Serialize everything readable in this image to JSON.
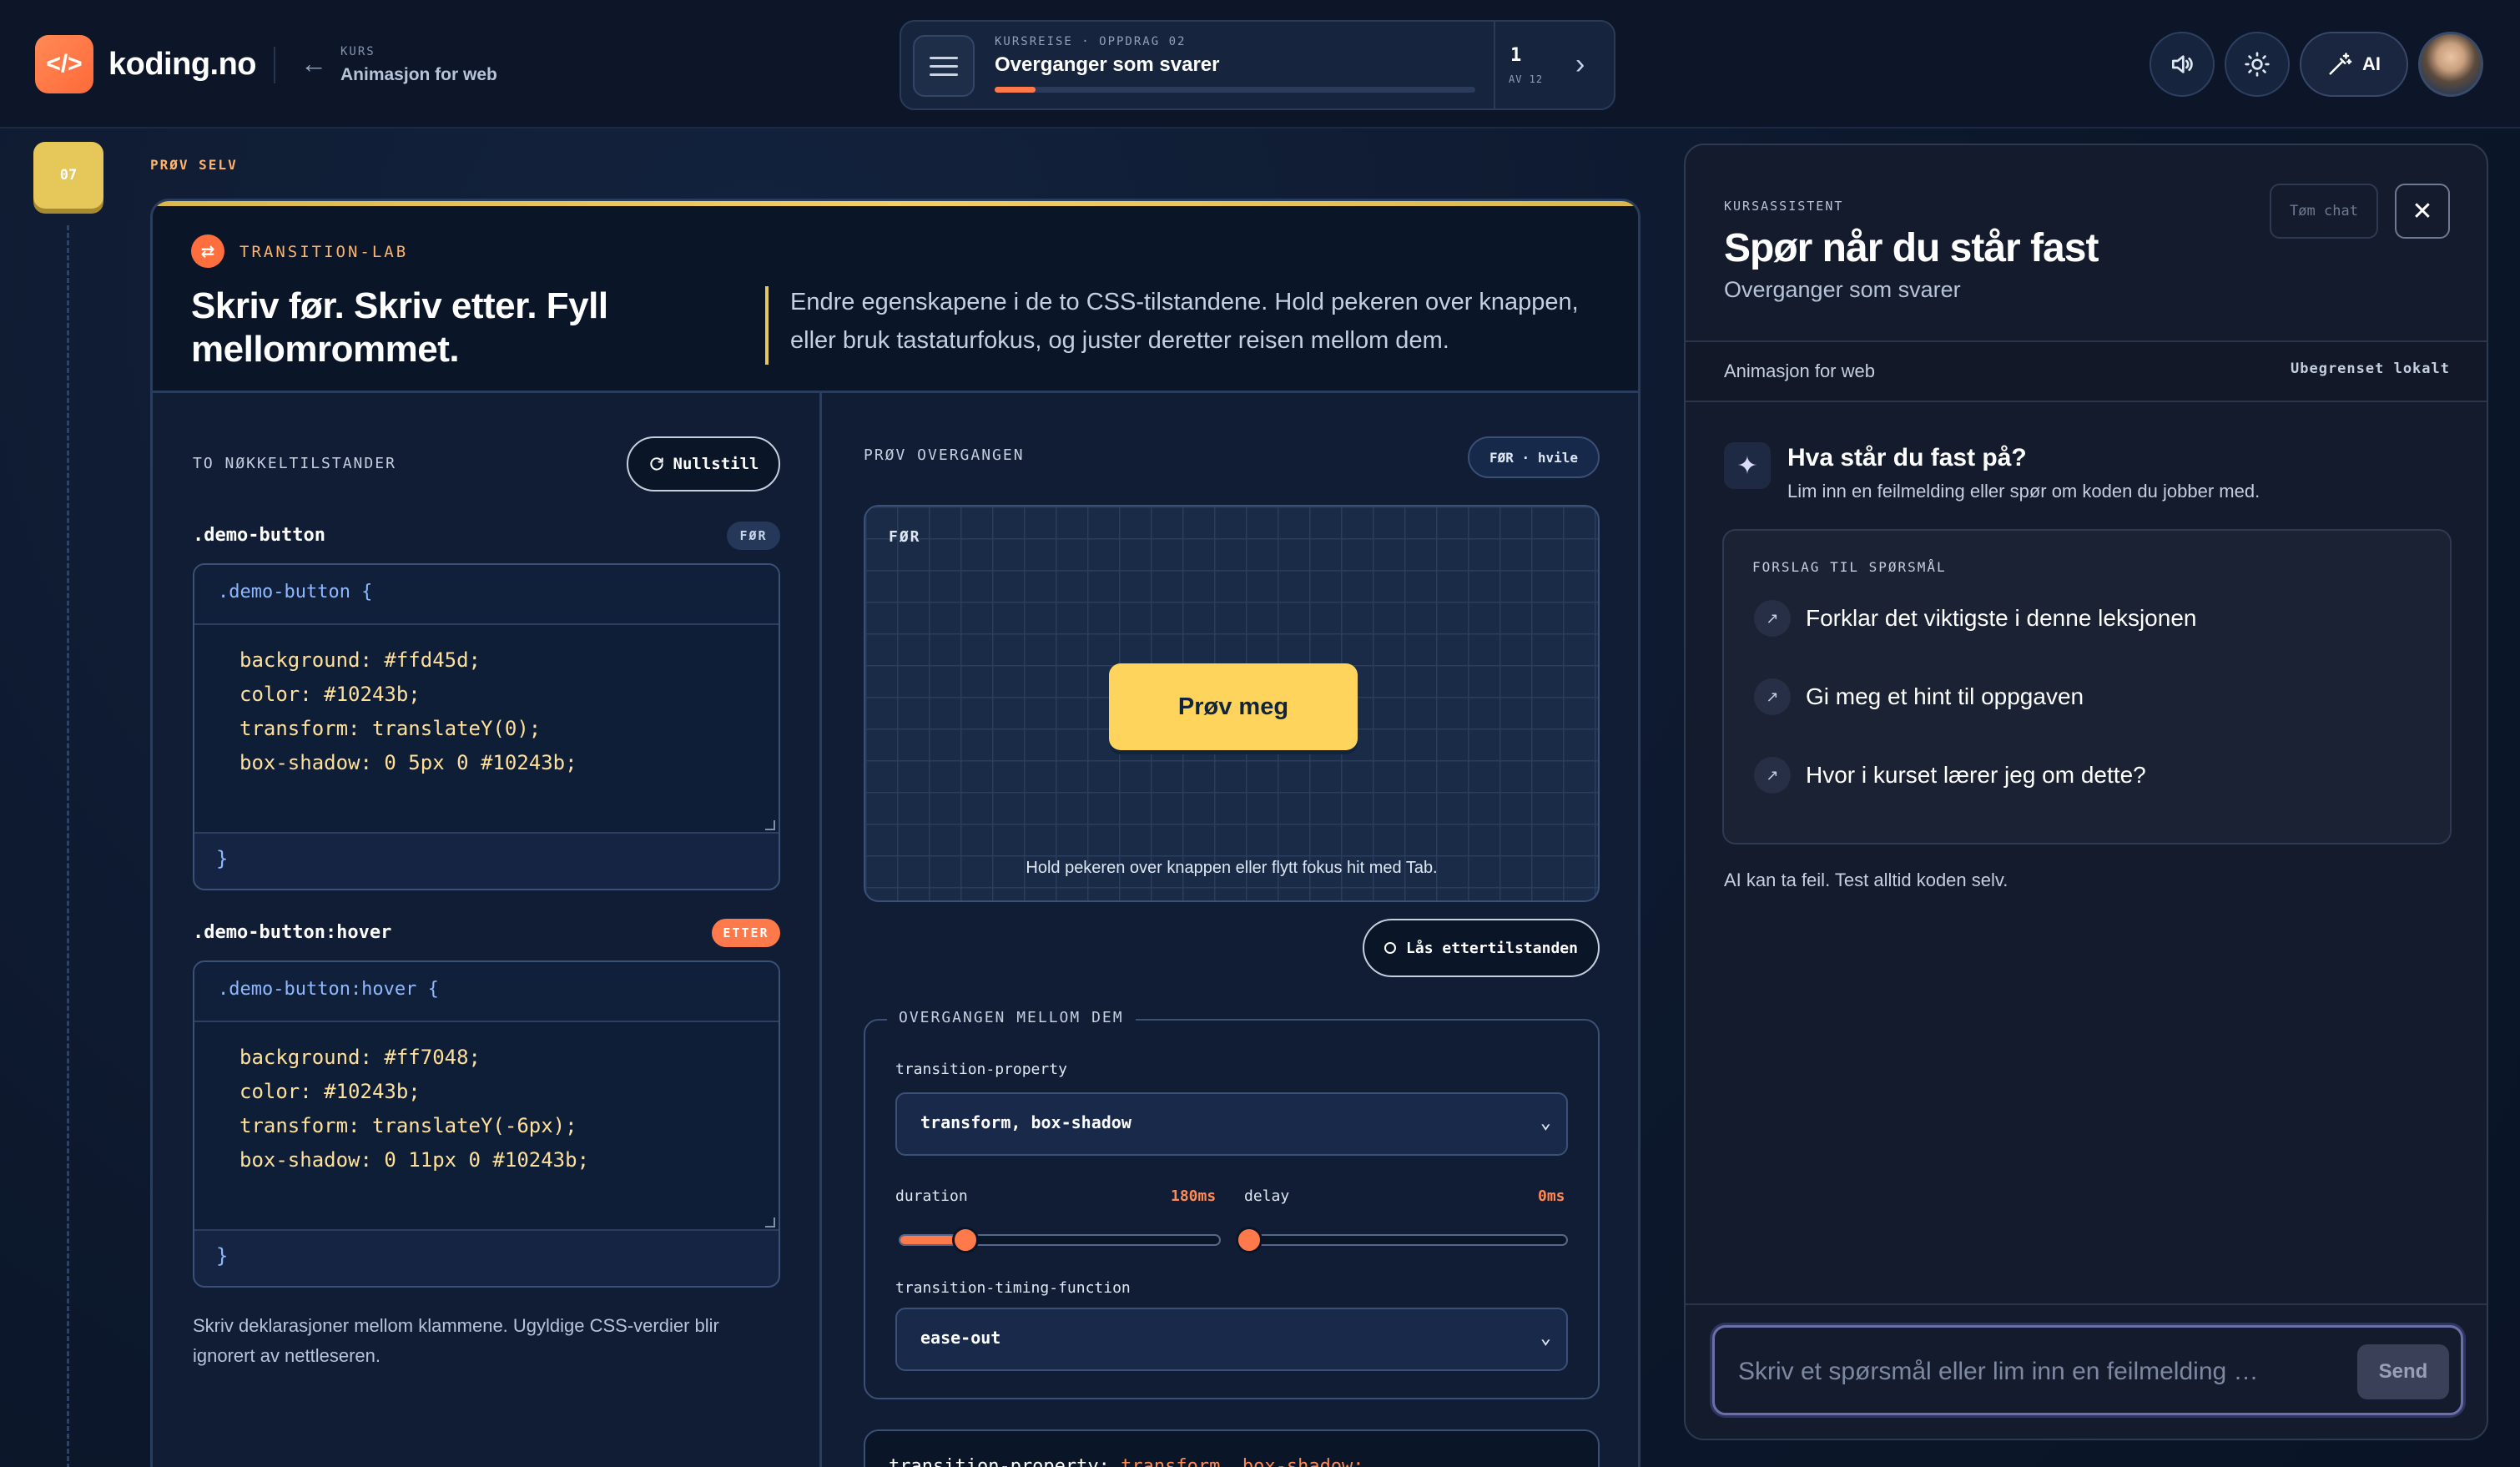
{
  "header": {
    "brand": "koding.no",
    "logo_glyph": "</>",
    "back_icon": "arrow-left-icon",
    "crumb_kicker": "KURS",
    "crumb_title": "Animasjon for web"
  },
  "progress": {
    "kicker": "KURSREISE · OPPDRAG 02",
    "title": "Overganger som svarer",
    "current": "1",
    "of_label": "AV 12",
    "fraction": 0.085
  },
  "toolbar": {
    "ai_label": "AI"
  },
  "rail": {
    "step": "07",
    "try_label": "PRØV SELV"
  },
  "lab": {
    "kicker": "TRANSITION-LAB",
    "title": "Skriv før. Skriv etter. Fyll mellomrommet.",
    "description": "Endre egenskapene i de to CSS-tilstandene. Hold pekeren over knappen, eller bruk tastaturfokus, og juster deretter reisen mellom dem.",
    "states_label": "TO NØKKELTILSTANDER",
    "reset_label": "Nullstill",
    "before": {
      "selector": ".demo-button",
      "tag": "FØR",
      "open": ".demo-button {",
      "lines": [
        "background: #ffd45d;",
        "color: #10243b;",
        "transform: translateY(0);",
        "box-shadow: 0 5px 0 #10243b;"
      ],
      "close": "}"
    },
    "after": {
      "selector": ".demo-button:hover",
      "tag": "ETTER",
      "open": ".demo-button:hover {",
      "lines": [
        "background: #ff7048;",
        "color: #10243b;",
        "transform: translateY(-6px);",
        "box-shadow: 0 11px 0 #10243b;"
      ],
      "close": "}"
    },
    "help": "Skriv deklarasjoner mellom klammene. Ugyldige CSS-verdier blir ignorert av nettleseren.",
    "try_label": "PRØV OVERGANGEN",
    "state_pill": "FØR · hvile",
    "stage_label": "FØR",
    "demo_button": "Prøv meg",
    "stage_hint": "Hold pekeren over knappen eller flytt fokus hit med Tab.",
    "lock_label": "Lås ettertilstanden",
    "transition": {
      "legend": "OVERGANGEN MELLOM DEM",
      "property_label": "transition-property",
      "property_value": "transform, box-shadow",
      "duration_label": "duration",
      "duration_value": "180ms",
      "duration_fraction": 0.2,
      "delay_label": "delay",
      "delay_value": "0ms",
      "delay_fraction": 0,
      "timing_label": "transition-timing-function",
      "timing_value": "ease-out"
    },
    "output": {
      "prop": "transition-property:",
      "value": "transform, box-shadow;"
    }
  },
  "assistant": {
    "kicker": "KURSASSISTENT",
    "title": "Spør når du står fast",
    "subtitle": "Overganger som svarer",
    "clear_label": "Tøm chat",
    "close_glyph": "✕",
    "course": "Animasjon for web",
    "limit": "Ubegrenset lokalt",
    "question_title": "Hva står du fast på?",
    "question_sub": "Lim inn en feilmelding eller spør om koden du jobber med.",
    "suggest_kicker": "FORSLAG TIL SPØRSMÅL",
    "suggestions": [
      "Forklar det viktigste i denne leksjonen",
      "Gi meg et hint til oppgaven",
      "Hvor i kurset lærer jeg om dette?"
    ],
    "disclaimer": "AI kan ta feil. Test alltid koden selv.",
    "input_placeholder": "Skriv et spørsmål eller lim inn en feilmelding …",
    "send_label": "Send"
  },
  "colors": {
    "accent_orange": "#ff7a4a",
    "accent_yellow": "#ffd45d",
    "navy": "#10243b"
  }
}
